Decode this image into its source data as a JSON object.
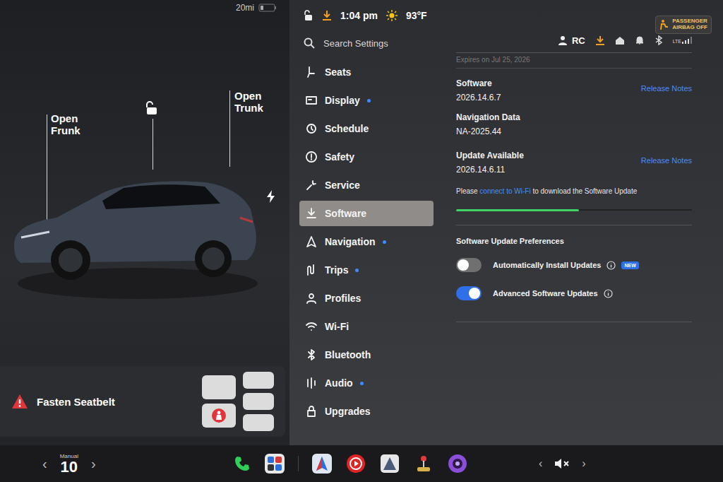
{
  "vehicle": {
    "range": "20mi",
    "frunk_label": "Open Frunk",
    "trunk_label": "Open Trunk",
    "locked": false,
    "charging_port_open": true
  },
  "alert": {
    "text": "Fasten Seatbelt"
  },
  "seats": [
    {
      "unbuckled": false
    },
    {
      "unbuckled": true
    },
    {
      "unbuckled": false
    },
    {
      "unbuckled": false
    },
    {
      "unbuckled": false
    }
  ],
  "status_bar": {
    "locked": false,
    "download_pending": true,
    "time": "1:04 pm",
    "temperature": "93°F",
    "airbag_lines": [
      "PASSENGER",
      "AIRBAG OFF"
    ]
  },
  "search": {
    "placeholder": "Search Settings"
  },
  "sidebar": {
    "items": [
      {
        "label": "Seats",
        "selected": false,
        "dot": false
      },
      {
        "label": "Display",
        "selected": false,
        "dot": true
      },
      {
        "label": "Schedule",
        "selected": false,
        "dot": false
      },
      {
        "label": "Safety",
        "selected": false,
        "dot": false
      },
      {
        "label": "Service",
        "selected": false,
        "dot": false
      },
      {
        "label": "Software",
        "selected": true,
        "dot": false
      },
      {
        "label": "Navigation",
        "selected": false,
        "dot": true
      },
      {
        "label": "Trips",
        "selected": false,
        "dot": true
      },
      {
        "label": "Profiles",
        "selected": false,
        "dot": false
      },
      {
        "label": "Wi-Fi",
        "selected": false,
        "dot": false
      },
      {
        "label": "Bluetooth",
        "selected": false,
        "dot": false
      },
      {
        "label": "Audio",
        "selected": false,
        "dot": true
      },
      {
        "label": "Upgrades",
        "selected": false,
        "dot": false
      }
    ]
  },
  "header": {
    "profile": "RC",
    "signal": "LTE"
  },
  "expires": "Expires on Jul 25, 2026",
  "software": {
    "label": "Software",
    "version": "2026.14.6.7",
    "link": "Release Notes"
  },
  "navigation_data": {
    "label": "Navigation Data",
    "version": "NA-2025.44"
  },
  "update": {
    "label": "Update Available",
    "version": "2026.14.6.11",
    "link": "Release Notes",
    "message_before": "Please ",
    "message_link": "connect to Wi-Fi",
    "message_after": " to download the Software Update",
    "level": 0.52
  },
  "preferences": {
    "title": "Software Update Preferences",
    "toggles": [
      {
        "label": "Automatically Install Updates",
        "on": false,
        "badge": "NEW"
      },
      {
        "label": "Advanced Software Updates",
        "on": true,
        "badge": null
      }
    ]
  },
  "dock": {
    "climate_mode": "Manual",
    "temperature": "10",
    "prev": "‹",
    "next": "›",
    "muted": true
  }
}
